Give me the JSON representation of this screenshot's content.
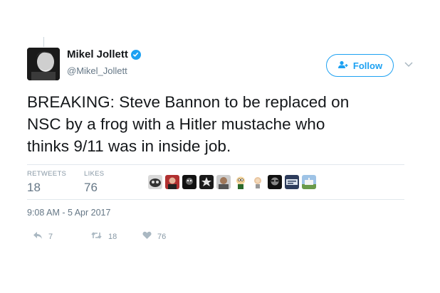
{
  "user": {
    "name": "Mikel Jollett",
    "handle": "@Mikel_Jollett",
    "verified": true
  },
  "follow_button": {
    "label": "Follow",
    "icon": "add-person-icon"
  },
  "tweet": {
    "lines": [
      "BREAKING: Steve Bannon to be replaced on",
      "NSC by a frog with a Hitler mustache who",
      "thinks 9/11 was in inside job."
    ],
    "timestamp": "9:08 AM - 5 Apr 2017"
  },
  "stats": {
    "retweets_label": "RETWEETS",
    "retweets": "18",
    "likes_label": "LIKES",
    "likes": "76"
  },
  "actions": {
    "reply_count": "7",
    "retweet_count": "18",
    "like_count": "76"
  },
  "colors": {
    "accent": "#1da1f2",
    "muted": "#657786",
    "light_muted": "#8899a6",
    "separator": "#e1e8ed"
  }
}
